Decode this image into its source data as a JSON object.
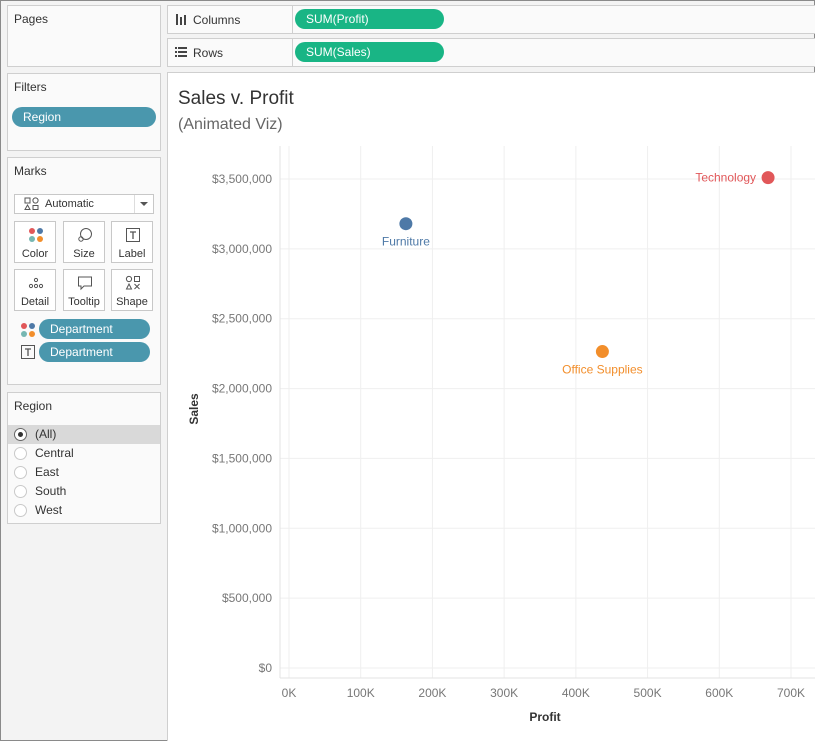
{
  "cards": {
    "pages": {
      "title": "Pages"
    },
    "filters": {
      "title": "Filters",
      "pill": "Region"
    },
    "marks": {
      "title": "Marks",
      "type": "Automatic",
      "buttons": {
        "color": "Color",
        "size": "Size",
        "label": "Label",
        "detail": "Detail",
        "tooltip": "Tooltip",
        "shape": "Shape"
      },
      "color_pill": "Department",
      "label_pill": "Department"
    },
    "region": {
      "title": "Region",
      "options": [
        "(All)",
        "Central",
        "East",
        "South",
        "West"
      ],
      "selected": "(All)"
    }
  },
  "shelves": {
    "columns": {
      "label": "Columns",
      "pill": "SUM(Profit)"
    },
    "rows": {
      "label": "Rows",
      "pill": "SUM(Sales)"
    }
  },
  "viz": {
    "title": "Sales v. Profit",
    "subtitle": "(Animated Viz)"
  },
  "chart_data": {
    "type": "scatter",
    "xlabel": "Profit",
    "ylabel": "Sales",
    "xlim": [
      0,
      720000
    ],
    "ylim": [
      0,
      3700000
    ],
    "x_ticks": [
      {
        "value": 0,
        "label": "0K"
      },
      {
        "value": 100000,
        "label": "100K"
      },
      {
        "value": 200000,
        "label": "200K"
      },
      {
        "value": 300000,
        "label": "300K"
      },
      {
        "value": 400000,
        "label": "400K"
      },
      {
        "value": 500000,
        "label": "500K"
      },
      {
        "value": 600000,
        "label": "600K"
      },
      {
        "value": 700000,
        "label": "700K"
      }
    ],
    "y_ticks": [
      {
        "value": 0,
        "label": "$0"
      },
      {
        "value": 500000,
        "label": "$500,000"
      },
      {
        "value": 1000000,
        "label": "$1,000,000"
      },
      {
        "value": 1500000,
        "label": "$1,500,000"
      },
      {
        "value": 2000000,
        "label": "$2,000,000"
      },
      {
        "value": 2500000,
        "label": "$2,500,000"
      },
      {
        "value": 3000000,
        "label": "$3,000,000"
      },
      {
        "value": 3500000,
        "label": "$3,500,000"
      }
    ],
    "grid": true,
    "points": [
      {
        "name": "Furniture",
        "x": 163000,
        "y": 3180000,
        "color": "#4e79a7",
        "label_pos": "below"
      },
      {
        "name": "Office Supplies",
        "x": 437000,
        "y": 2265000,
        "color": "#f28e2b",
        "label_pos": "below"
      },
      {
        "name": "Technology",
        "x": 668000,
        "y": 3510000,
        "color": "#e15759",
        "label_pos": "left"
      }
    ]
  }
}
